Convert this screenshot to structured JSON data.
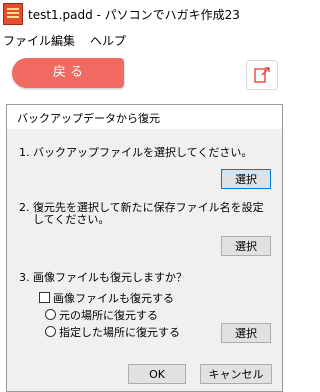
{
  "window": {
    "title": "test1.padd - パソコンでハガキ作成23"
  },
  "menu": [
    "ファイル",
    "編集",
    "ヘルプ"
  ],
  "toolbar": {
    "back_label": "戻 る",
    "export_icon": "export-icon"
  },
  "dialog": {
    "title": "バックアップデータから復元",
    "step1": "1. バックアップファイルを選択してください。",
    "step2_line1": "2. 復元先を選択して新たに保存ファイル名を設定",
    "step2_line2": "してください。",
    "step3": "3. 画像ファイルも復元しますか？",
    "select_label": "選択",
    "restore_images_label": "画像ファイルも復元する",
    "radio_original": "元の場所に復元する",
    "radio_specified": "指定した場所に復元する",
    "ok_label": "OK",
    "cancel_label": "キャンセル"
  },
  "colors": {
    "back_button": "#f06a62",
    "focus_border": "#0078d7"
  }
}
